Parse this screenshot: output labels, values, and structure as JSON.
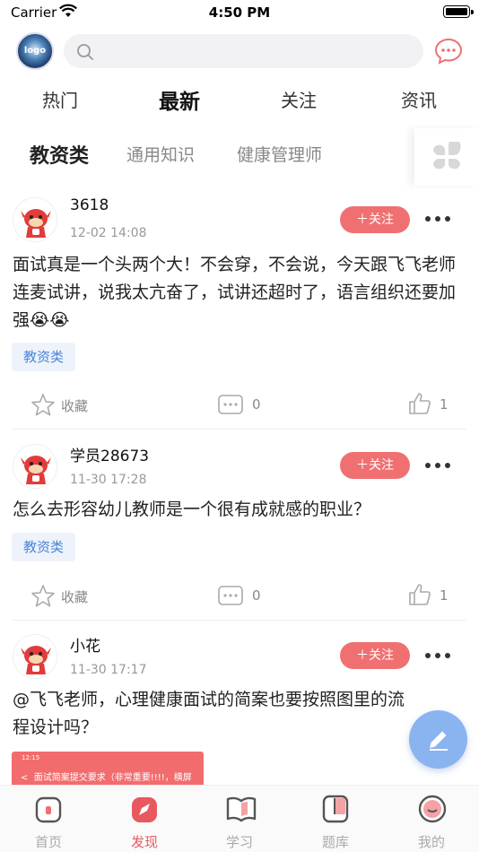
{
  "status_bar": {
    "carrier": "Carrier",
    "time": "4:50 PM"
  },
  "search": {
    "placeholder": ""
  },
  "main_tabs": [
    "热门",
    "最新",
    "关注",
    "资讯"
  ],
  "sub_tabs": [
    "教资类",
    "通用知识",
    "健康管理师"
  ],
  "posts": [
    {
      "username": "3618",
      "time": "12-02 14:08",
      "follow_label": "＋关注",
      "text": "面试真是一个头两个大！不会穿，不会说，今天跟飞飞老师连麦试讲，说我太亢奋了，试讲还超时了，语言组织还要加强😭😭",
      "tag": "教资类",
      "favorite_label": "收藏",
      "comments": "0",
      "likes": "1"
    },
    {
      "username": "学员28673",
      "time": "11-30 17:28",
      "follow_label": "＋关注",
      "text": "怎么去形容幼儿教师是一个很有成就感的职业？",
      "tag": "教资类",
      "favorite_label": "收藏",
      "comments": "0",
      "likes": "1"
    },
    {
      "username": "小花",
      "time": "11-30 17:17",
      "follow_label": "＋关注",
      "text": "@飞飞老师，心理健康面试的简案也要按照图里的流程设计吗？",
      "image_caption": "面试简案提交要求（非常重要!!!!，横屏",
      "image_status": "12:15"
    }
  ],
  "tab_bar": [
    "首页",
    "发现",
    "学习",
    "题库",
    "我的"
  ],
  "colors": {
    "accent": "#f07072",
    "tag_text": "#4a86d8",
    "fab": "#8ab4f0"
  }
}
